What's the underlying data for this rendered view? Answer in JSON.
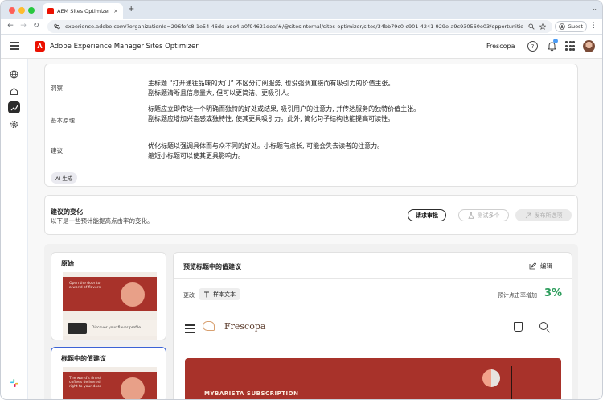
{
  "browser": {
    "tab_title": "AEM Sites Optimizer | Adobe",
    "tab_close": "×",
    "new_tab": "+",
    "tab_dropdown": "⌄",
    "url": "experience.adobe.com/?organizationId=296fefc8-1e54-46dd-aee4-a0f94621deaf#/@sitesinternal/sites-optimizer/sites/34bb79c0-c901-4241-929e-a9c930560e03/opportunities/d887438...",
    "guest_label": "Guest"
  },
  "app": {
    "product_name": "Adobe Experience Manager Sites Optimizer",
    "org_name": "Frescopa"
  },
  "insights": {
    "rows": [
      {
        "label": "洞察",
        "lines": [
          "主标题 “打开通往品味的大门” 不区分订阅服务, 也没强调直接而有吸引力的价值主张。",
          "副标题清晰且信息量大, 但可以更简洁、更吸引人。"
        ]
      },
      {
        "label": "基本原理",
        "lines": [
          "标题应立即传达一个明确而独特的好处或结果, 吸引用户的注意力, 并传达服务的独特价值主张。",
          "副标题应增加兴奋感或独特性, 使其更具吸引力。此外, 简化句子结构也能提高可读性。"
        ]
      },
      {
        "label": "建议",
        "lines": [
          "优化标题以强调具体而与众不同的好处。小标题有点长, 可能会失去读者的注意力。",
          "缩短小标题可以使其更具影响力。"
        ]
      }
    ],
    "ai_badge": "AI 生成"
  },
  "changes": {
    "title": "建议的变化",
    "subtitle": "以下是一些预计能提高点击率的变化。",
    "request_review": "请求审批",
    "test_multiple": "测试多个",
    "publish_selected": "发布所选项"
  },
  "variants": {
    "original_label": "原始",
    "suggestion_label": "标题中的值建议",
    "original_thumb_heading": "Open the door to a world of flavors.",
    "original_thumb_sub": "Discover your flavor profile.",
    "suggestion_thumb_heading": "The world's finest coffees delivered right to your door"
  },
  "preview": {
    "title": "预览标题中的值建议",
    "edit_label": "编辑",
    "change_label": "更改",
    "change_chip": "样本文本",
    "ctr_label": "预计点击率增加",
    "ctr_value": "3%",
    "site_brand": "Frescopa",
    "hero_label": "MYBARISTA SUBSCRIPTION"
  },
  "colors": {
    "accent_red": "#eb1000",
    "hero_red": "#a8322a",
    "ctr_green": "#2d9d5c",
    "selected_border": "#3b63d6"
  }
}
